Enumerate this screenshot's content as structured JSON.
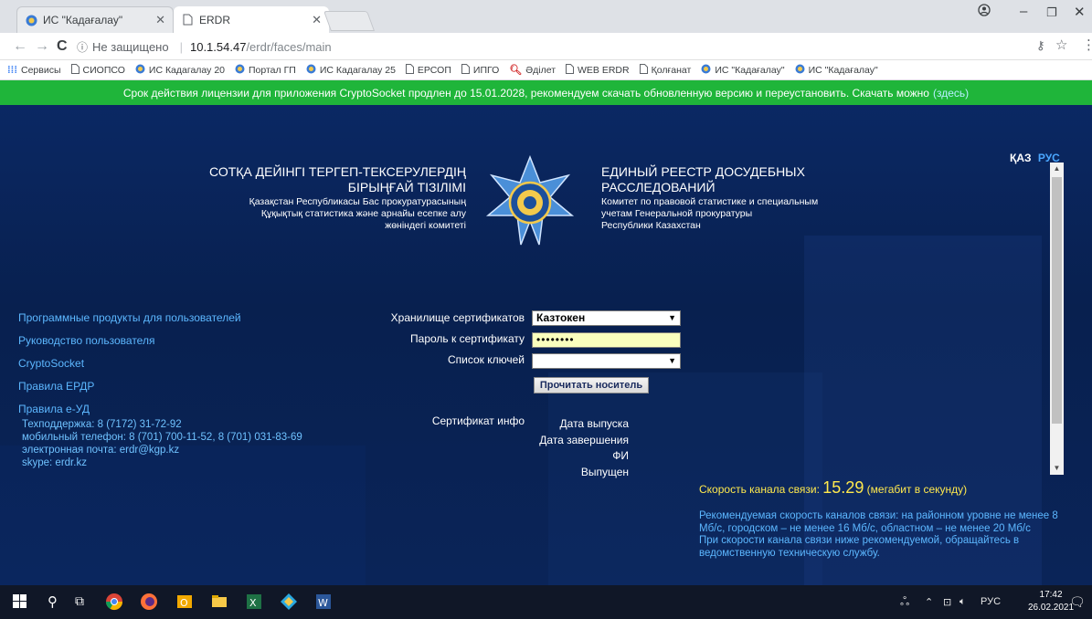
{
  "browser": {
    "tabs": [
      {
        "title": "ИС \"Кадағалау\"",
        "icon": "emblem-icon"
      },
      {
        "title": "ERDR",
        "icon": "page-icon"
      }
    ],
    "address": {
      "security": "Не защищено",
      "host": "10.1.54.47",
      "path": "/erdr/faces/main"
    },
    "bookmarks": [
      {
        "label": "Сервисы",
        "icon": "apps-icon"
      },
      {
        "label": "СИОПСО",
        "icon": "page-icon"
      },
      {
        "label": "ИС Кадагалау 20",
        "icon": "emblem-icon"
      },
      {
        "label": "Портал ГП",
        "icon": "emblem-icon"
      },
      {
        "label": "ИС Кадагалау 25",
        "icon": "emblem-icon"
      },
      {
        "label": "ЕРСОП",
        "icon": "page-icon"
      },
      {
        "label": "ИПГО",
        "icon": "page-icon"
      },
      {
        "label": "Әділет",
        "icon": "search-icon"
      },
      {
        "label": "WEB ERDR",
        "icon": "page-icon"
      },
      {
        "label": "Қолғанат",
        "icon": "page-icon"
      },
      {
        "label": "ИС \"Кадағалау\"",
        "icon": "emblem-icon"
      },
      {
        "label": "ИС \"Кадағалау\"",
        "icon": "emblem-icon"
      }
    ]
  },
  "notice": {
    "text": "Срок действия лицензии для приложения CryptoSocket продлен до 15.01.2028, рекомендуем скачать обновленную версию и переустановить. Скачать можно",
    "link": "(здесь)"
  },
  "lang": {
    "kaz": "ҚАЗ",
    "rus": "РУС"
  },
  "header": {
    "kz_line1": "СОТҚА ДЕЙІНГІ ТЕРГЕП-ТЕКСЕРУЛЕРДІҢ",
    "kz_line2": "БІРЫҢҒАЙ ТІЗІЛІМІ",
    "kz_sub1": "Қазақстан Республикасы Бас прокуратурасының",
    "kz_sub2": "Құқықтық статистика және арнайы есепке алу",
    "kz_sub3": "жөніндегі комитеті",
    "ru_line1": "ЕДИНЫЙ РЕЕСТР ДОСУДЕБНЫХ",
    "ru_line2": "РАССЛЕДОВАНИЙ",
    "ru_sub1": "Комитет по правовой статистике и специальным",
    "ru_sub2": "учетам Генеральной прокуратуры",
    "ru_sub3": "Республики Казахстан"
  },
  "links": [
    "Программные продукты для пользователей",
    "Руководство пользователя",
    "CryptoSocket",
    "Правила ЕРДР",
    "Правила е-УД"
  ],
  "contacts": {
    "support": "Техподдержка: 8 (7172) 31-72-92",
    "mobile": "мобильный телефон: 8 (701) 700-11-52, 8 (701) 031-83-69",
    "email": "электронная почта: erdr@kgp.kz",
    "skype": "skype: erdr.kz"
  },
  "form": {
    "storage_label": "Хранилище сертификатов",
    "storage_value": "Казтокен",
    "password_label": "Пароль к сертификату",
    "password_value": "••••••••",
    "keys_label": "Список ключей",
    "keys_value": "",
    "read_button": "Прочитать носитель",
    "cert_info_label": "Сертификат инфо",
    "cert_fields": [
      "Дата выпуска",
      "Дата завершения",
      "ФИ",
      "Выпущен"
    ]
  },
  "speed": {
    "label": "Скорость канала связи:",
    "value": "15.29",
    "unit": "(мегабит в секунду)"
  },
  "recommend": {
    "line1": "Рекомендуемая скорость каналов связи: на районном уровне не менее 8 Мб/с, городском – не менее 16 Мб/с, областном – не менее 20 Мб/с",
    "line2": "При скорости канала связи ниже рекомендуемой, обращайтесь в ведомственную техническую службу."
  },
  "taskbar": {
    "lang": "РУС",
    "time": "17:42",
    "date": "26.02.2021"
  },
  "colors": {
    "page_bg": "#0b2966",
    "notice_bg": "#1fb53a",
    "link": "#5cb7ff",
    "speed": "#ffe94d"
  }
}
